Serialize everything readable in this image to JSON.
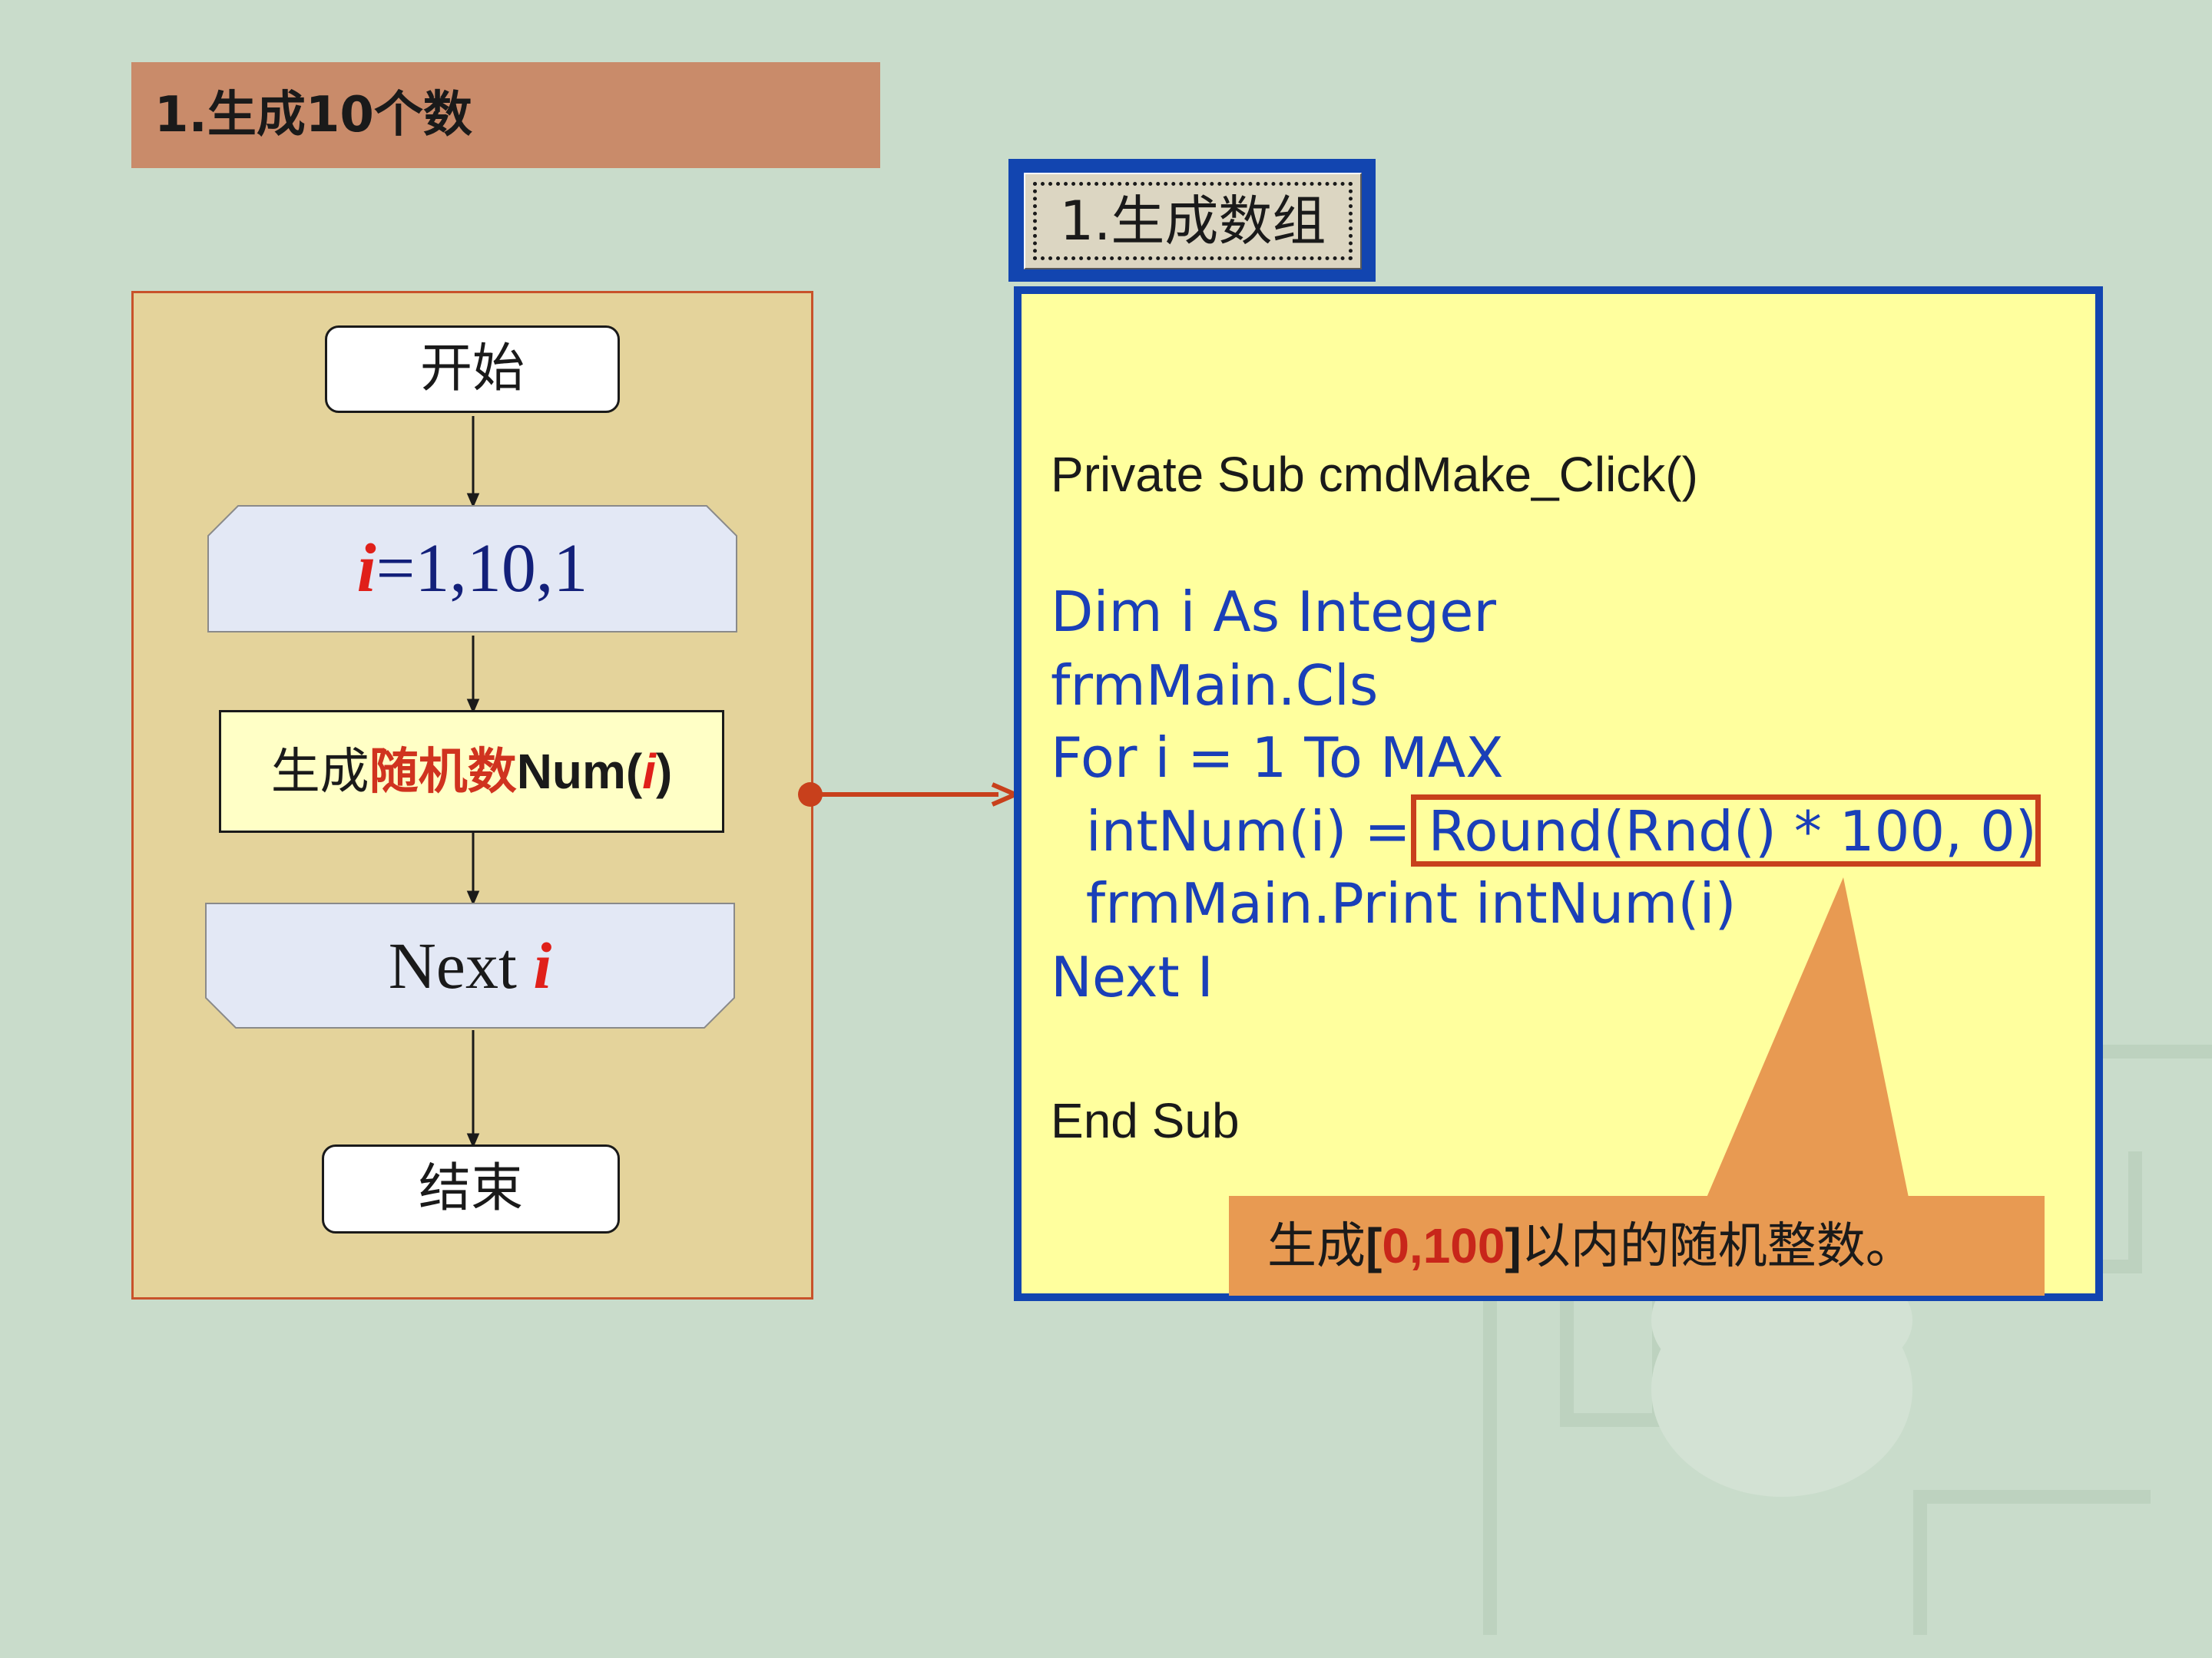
{
  "title": "1.生成10个数",
  "flowchart": {
    "start": "开始",
    "loop_start": {
      "var": "i",
      "rest": "=1,10,1"
    },
    "process": {
      "prefix": "生成",
      "highlight": "随机数",
      "func": "Num(",
      "var": "i",
      "close": ")"
    },
    "loop_end": {
      "text": "Next ",
      "var": "i"
    },
    "end": "结束"
  },
  "button": {
    "label": "1.生成数组"
  },
  "code": {
    "line1": "Private Sub cmdMake_Click()",
    "line2": "Dim i As Integer",
    "line3": "frmMain.Cls",
    "line4": "For i = 1 To MAX",
    "line5": "  intNum(i) = Round(Rnd() * 100, 0)",
    "line6": "  frmMain.Print intNum(i)",
    "line7": "Next I",
    "line8": "End Sub"
  },
  "callout": {
    "prefix": "生成",
    "bracket_open": "[",
    "range": "0,100",
    "bracket_close": "]",
    "suffix": "以内的随机整数。"
  },
  "colors": {
    "background": "#c9dccb",
    "title_bar": "#c98b6a",
    "flow_panel": "#e4d39b",
    "code_panel": "#ffff9e",
    "code_border": "#1245b0",
    "code_blue": "#1a3fb8",
    "accent_red": "#c8401c",
    "callout": "#e89a52"
  }
}
